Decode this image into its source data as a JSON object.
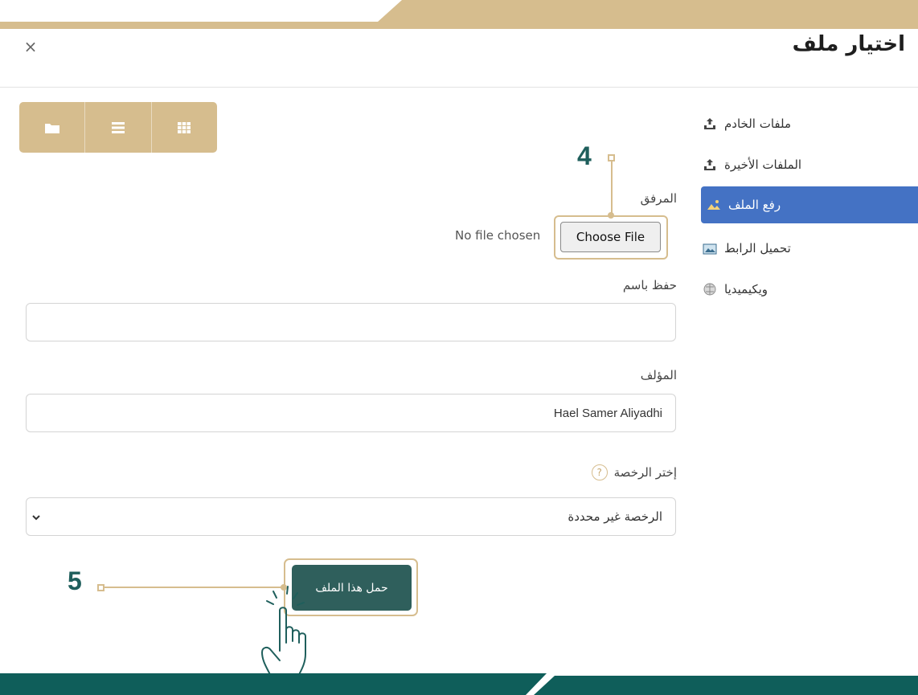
{
  "dialog": {
    "title": "اختيار ملف",
    "close_label": "×"
  },
  "sidebar": {
    "items": [
      {
        "label": "ملفات الخادم",
        "icon": "server-upload-icon",
        "active": false
      },
      {
        "label": "الملفات الأخيرة",
        "icon": "recent-upload-icon",
        "active": false
      },
      {
        "label": "رفع الملف",
        "icon": "upload-file-icon",
        "active": true
      },
      {
        "label": "تحميل الرابط",
        "icon": "download-link-icon",
        "active": false
      },
      {
        "label": "ويكيميديا",
        "icon": "wikimedia-icon",
        "active": false
      }
    ]
  },
  "toolbar": {
    "views": [
      "folder-view-icon",
      "list-view-icon",
      "grid-view-icon"
    ]
  },
  "form": {
    "attachment_label": "المرفق",
    "choose_file_label": "Choose File",
    "no_file_text": "No file chosen",
    "save_as_label": "حفظ باسم",
    "save_as_value": "",
    "author_label": "المؤلف",
    "author_value": "Hael Samer Aliyadhi",
    "license_label": "إختر الرخصة",
    "license_help": "?",
    "license_value": "الرخصة غير محددة",
    "submit_label": "حمل هذا الملف"
  },
  "callouts": {
    "step4": "4",
    "step5": "5"
  },
  "colors": {
    "accent_gold": "#d6bd8e",
    "teal": "#0f5e5a",
    "active_blue": "#4472c4",
    "button_teal": "#2f5f5c"
  }
}
